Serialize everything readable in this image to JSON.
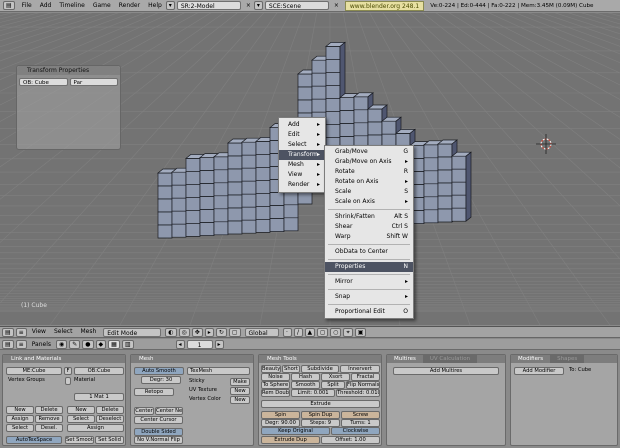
{
  "topbar": {
    "menus": [
      "File",
      "Add",
      "Timeline",
      "Game",
      "Render",
      "Help"
    ],
    "screen": "SR:2-Model",
    "scene": "SCE:Scene",
    "url": "www.blender.org 248.1",
    "stats": "Ve:0-224 | Ed:0-444 | Fa:0-222 | Mem:3.45M (0.09M) Cube"
  },
  "transform_panel": {
    "title": "Transform Properties",
    "ob_field": "OB: Cube",
    "par_field": "Par"
  },
  "context_menu": {
    "items": [
      "Add",
      "Edit",
      "Select",
      "Transform",
      "Mesh",
      "View",
      "Render"
    ],
    "highlighted": "Transform"
  },
  "transform_submenu": {
    "items": [
      {
        "label": "Grab/Move",
        "shortcut": "G"
      },
      {
        "label": "Grab/Move on Axis",
        "shortcut": "▸"
      },
      {
        "label": "Rotate",
        "shortcut": "R"
      },
      {
        "label": "Rotate on Axis",
        "shortcut": "▸"
      },
      {
        "label": "Scale",
        "shortcut": "S"
      },
      {
        "label": "Scale on Axis",
        "shortcut": "▸"
      },
      {
        "label": "Shrink/Fatten",
        "shortcut": "Alt S"
      },
      {
        "label": "Shear",
        "shortcut": "Ctrl S"
      },
      {
        "label": "Warp",
        "shortcut": "Shift W"
      },
      {
        "label": "ObData to Center",
        "shortcut": ""
      },
      {
        "label": "Properties",
        "shortcut": "N"
      },
      {
        "label": "Mirror",
        "shortcut": "▸"
      },
      {
        "label": "Snap",
        "shortcut": "▸"
      },
      {
        "label": "Proportional Edit",
        "shortcut": "O"
      }
    ],
    "highlighted": "Properties"
  },
  "viewport": {
    "object_label": "(1) Cube"
  },
  "view_header": {
    "menus": [
      "View",
      "Select",
      "Mesh"
    ],
    "mode": "Edit Mode",
    "orientation": "Global"
  },
  "buttons_header": {
    "panels_label": "Panels",
    "frame": "1"
  },
  "link_panel": {
    "tab": "Link and Materials",
    "me_field": "ME:Cube",
    "f_label": "F",
    "ob_field": "OB:Cube",
    "vertex_groups": "Vertex Groups",
    "material": "Material",
    "mat_index": "1 Mat 1",
    "buttons": [
      "New",
      "Delete",
      "Assign",
      "Remove",
      "Select",
      "Desel."
    ],
    "buttons2": [
      "New",
      "Delete",
      "Select",
      "Deselect",
      "Assign"
    ],
    "bottom": [
      "AutoTexSpace",
      "Set Smooth",
      "Set Solid"
    ]
  },
  "mesh_panel": {
    "tab": "Mesh",
    "auto_smooth": "Auto Smooth",
    "degr": "Degr: 30",
    "retopo": "Retopo",
    "center": "Center",
    "center_new": "Center New",
    "center_cursor": "Center Cursor",
    "double_sided": "Double Sided",
    "no_vnormal_flip": "No V.Normal Flip",
    "texmesh": "TexMesh",
    "sticky": "Sticky",
    "uv_texture": "UV Texture",
    "vertex_color": "Vertex Color",
    "make": "Make",
    "new": "New",
    "new2": "New"
  },
  "mesh_tools_panel": {
    "tab": "Mesh Tools",
    "row1": [
      "Beauty",
      "Short",
      "Subdivide",
      "Innervert"
    ],
    "row2": [
      "Noise",
      "Hash",
      "Xsort",
      "Fractal"
    ],
    "row3": [
      "To Sphere",
      "Smooth",
      "Split",
      "Flip Normals"
    ],
    "row4": [
      "Rem Doubles",
      "Limit: 0.001",
      "Threshold: 0.010"
    ],
    "extrude": "Extrude",
    "spin": "Spin",
    "spin_dup": "Spin Dup",
    "screw": "Screw",
    "degr": "Degr: 90.00",
    "steps": "Steps: 9",
    "turns": "Turns: 1",
    "keep_original": "Keep Original",
    "clockwise": "Clockwise",
    "extrude_dup": "Extrude Dup",
    "offset": "Offset: 1.00"
  },
  "multires_panel": {
    "tab": "Multires",
    "tab2": "UV Calculation",
    "add_multires": "Add Multires"
  },
  "modifiers_panel": {
    "tab": "Modifiers",
    "tab2": "Shapes",
    "add_modifier": "Add Modifier",
    "to": "To: Cube"
  },
  "colors": {
    "viewport_bg": "#737373",
    "grid_line": "#808080",
    "mesh_face": "#8e98ad",
    "mesh_edge": "#1a1c22",
    "menu_highlight": "#4d5362",
    "url_bg": "#e7e0a2"
  }
}
